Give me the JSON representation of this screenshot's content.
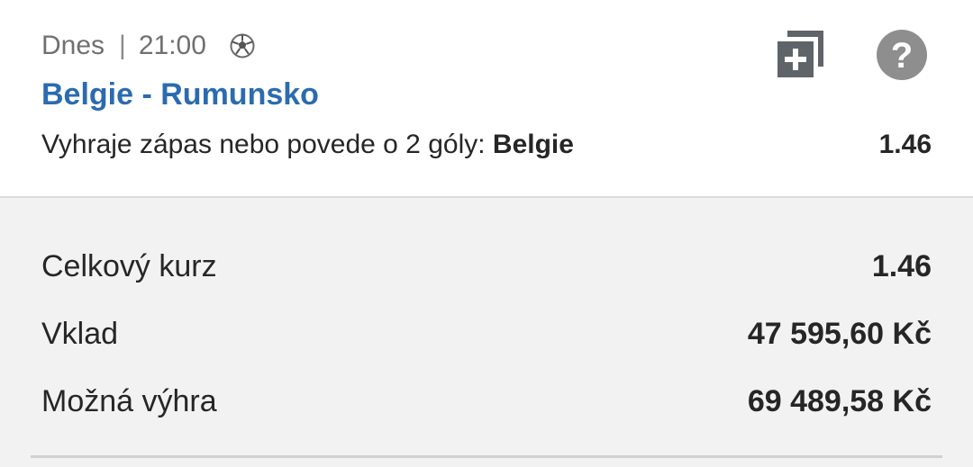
{
  "bet": {
    "day": "Dnes",
    "separator": "|",
    "time": "21:00",
    "sport_icon": "soccer-ball-icon",
    "match": "Belgie - Rumunsko",
    "market": "Vyhraje zápas nebo povede o 2 góly: ",
    "pick": "Belgie",
    "odd": "1.46",
    "actions": {
      "copy_icon": "copy-add-icon",
      "help_icon": "help-icon",
      "help_glyph": "?"
    }
  },
  "summary": {
    "total_odds_label": "Celkový kurz",
    "total_odds_value": "1.46",
    "stake_label": "Vklad",
    "stake_value": "47 595,60 Kč",
    "win_label": "Možná výhra",
    "win_value": "69 489,58 Kč"
  },
  "colors": {
    "match_blue": "#2b6bb0",
    "icon_dark": "#5f6469",
    "icon_grey": "#8e8e8e",
    "background": "#f2f2f2"
  }
}
